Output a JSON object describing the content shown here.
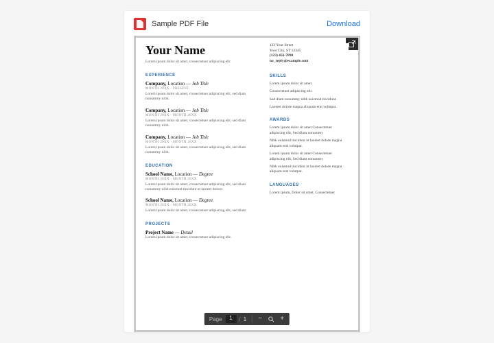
{
  "header": {
    "file_title": "Sample PDF File",
    "download_label": "Download"
  },
  "resume": {
    "name": "Your Name",
    "tagline": "Lorem ipsum dolor sit amet, consectetuer adipiscing elit",
    "contact": {
      "street": "123 Your Street",
      "city_state_zip": "Your City, ST 12345",
      "phone": "(123) 456-7890",
      "email": "no_reply@example.com"
    },
    "sections": {
      "experience": {
        "title": "EXPERIENCE",
        "items": [
          {
            "company": "Company,",
            "location": "Location",
            "role": "Job Title",
            "dates": "MONTH 20XX - PRESENT",
            "body": "Lorem ipsum dolor sit amet, consectetuer adipiscing elit, sed diam nonummy nibh."
          },
          {
            "company": "Company,",
            "location": "Location",
            "role": "Job Title",
            "dates": "MONTH 20XX - MONTH 20XX",
            "body": "Lorem ipsum dolor sit amet, consectetuer adipiscing elit, sed diam nonummy nibh."
          },
          {
            "company": "Company,",
            "location": "Location",
            "role": "Job Title",
            "dates": "MONTH 20XX - MONTH 20XX",
            "body": "Lorem ipsum dolor sit amet, consectetuer adipiscing elit, sed diam nonummy nibh."
          }
        ]
      },
      "education": {
        "title": "EDUCATION",
        "items": [
          {
            "school": "School Name,",
            "location": "Location",
            "degree": "Degree",
            "dates": "MONTH 20XX - MONTH 20XX",
            "body": "Lorem ipsum dolor sit amet, consectetuer adipiscing elit, sed diam nonummy nibh euismod tincidunt ut laoreet dolore."
          },
          {
            "school": "School Name,",
            "location": "Location",
            "degree": "Degree",
            "dates": "MONTH 20XX - MONTH 20XX",
            "body": "Lorem ipsum dolor sit amet, consectetuer adipiscing elit, sed diam"
          }
        ]
      },
      "projects": {
        "title": "PROJECTS",
        "items": [
          {
            "name": "Project Name",
            "detail": "Detail",
            "body": "Lorem ipsum dolor sit amet, consectetuer adipiscing elit."
          }
        ]
      },
      "skills": {
        "title": "SKILLS",
        "lines": [
          "Lorem ipsum dolor sit amet.",
          "Consectetuer adipiscing elit.",
          "Sed diam nonummy nibh euismod tincidunt.",
          "Laoreet dolore magna aliquam erat volutpat."
        ]
      },
      "awards": {
        "title": "AWARDS",
        "lines": [
          "Lorem ipsum dolor sit amet Consectetuer adipiscing elit, Sed diam nonummy",
          "Nibh euismod tincidunt ut laoreet dolore magna aliquam erat volutpat.",
          "Lorem ipsum dolor sit amet Consectetuer adipiscing elit, Sed diam nonummy",
          "Nibh euismod tincidunt ut laoreet dolore magna aliquam erat volutpat."
        ]
      },
      "languages": {
        "title": "LANGUAGES",
        "line": "Lorem ipsum, Dolor sit amet, Consectetuer"
      }
    }
  },
  "toolbar": {
    "page_label": "Page",
    "current_page": "1",
    "page_sep": "/",
    "total_pages": "1",
    "zoom_out": "−",
    "zoom_in": "+"
  }
}
